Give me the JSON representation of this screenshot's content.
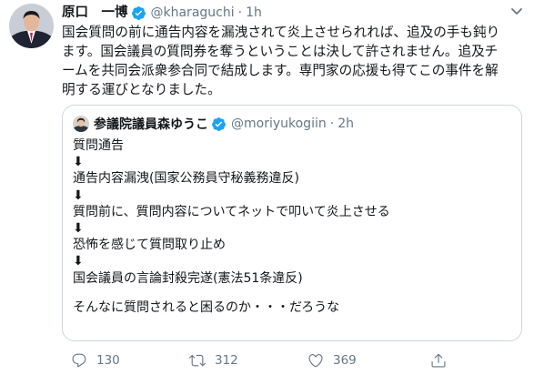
{
  "author": {
    "name": "原口　一博",
    "handle": "@kharaguchi",
    "separator": "·",
    "time": "1h"
  },
  "tweet_lines": [
    "国会質問の前に通告内容を漏洩されて炎上させられれば、追及の手も鈍り",
    "ます。国会議員の質問券を奪うということは決して許されません。追及チ",
    "ームを共同会派衆参合同で結成します。専門家の応援も得てこの事件を解",
    "明する運びとなりました。"
  ],
  "quoted": {
    "name": "参議院議員森ゆうこ",
    "handle": "@moriyukogiin",
    "separator": "·",
    "time": "2h",
    "lines": [
      "質問通告",
      "⬇",
      "通告内容漏洩(国家公務員守秘義務違反)",
      "⬇",
      "質問前に、質問内容についてネットで叩いて炎上させる",
      "⬇",
      "恐怖を感じて質問取り止め",
      "⬇",
      "国会議員の言論封殺完遂(憲法51条違反)"
    ],
    "closing": "そんなに質問されると困るのか・・・だろうな"
  },
  "actions": {
    "reply_icon": "reply-icon",
    "replies": "130",
    "retweet_icon": "retweet-icon",
    "retweets": "312",
    "like_icon": "heart-icon",
    "likes": "369",
    "share_icon": "share-icon"
  },
  "colors": {
    "verified": "#1da1f2",
    "secondary_text": "#657786",
    "border": "#ccd6dd"
  }
}
